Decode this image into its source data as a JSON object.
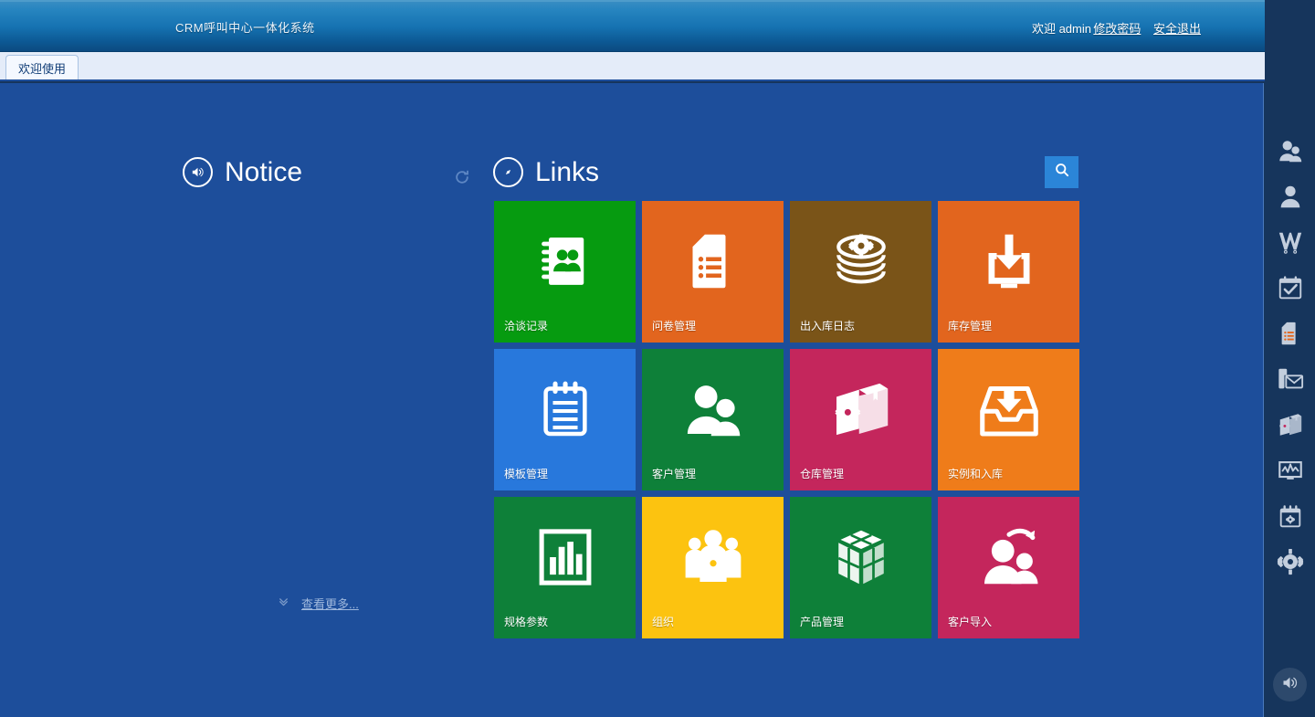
{
  "header": {
    "app_title": "CRM呼叫中心一体化系统",
    "welcome": "欢迎 admin",
    "change_password": "修改密码",
    "logout": "安全退出"
  },
  "tabbar": {
    "active_tab": "欢迎使用"
  },
  "notice": {
    "icon": "speaker-icon",
    "title": "Notice",
    "refresh_icon": "refresh-icon",
    "more_label": "查看更多...",
    "more_icon": "chevron-double-down-icon"
  },
  "links": {
    "icon": "compass-icon",
    "title": "Links",
    "search_icon": "search-icon"
  },
  "tiles": [
    {
      "label": "洽谈记录",
      "color": "#069b10",
      "icon": "contact-book-icon"
    },
    {
      "label": "问卷管理",
      "color": "#e2651e",
      "icon": "document-list-icon"
    },
    {
      "label": "出入库日志",
      "color": "#7a5418",
      "icon": "database-gear-icon"
    },
    {
      "label": "库存管理",
      "color": "#e2651e",
      "icon": "download-to-monitor-icon"
    },
    {
      "label": "模板管理",
      "color": "#2878dc",
      "icon": "notepad-icon"
    },
    {
      "label": "客户管理",
      "color": "#0e8039",
      "icon": "two-users-icon"
    },
    {
      "label": "仓库管理",
      "color": "#c4265c",
      "icon": "box-gear-icon"
    },
    {
      "label": "实例和入库",
      "color": "#ef7c1a",
      "icon": "inbox-download-icon"
    },
    {
      "label": "规格参数",
      "color": "#0e8039",
      "icon": "bar-chart-frame-icon"
    },
    {
      "label": "组织",
      "color": "#fcc310",
      "icon": "people-gear-icon"
    },
    {
      "label": "产品管理",
      "color": "#0e8039",
      "icon": "cube-blocks-icon"
    },
    {
      "label": "客户导入",
      "color": "#c4265c",
      "icon": "user-import-arrow-icon"
    }
  ],
  "rail": {
    "items": [
      {
        "icon": "two-users-icon",
        "name": "customers"
      },
      {
        "icon": "single-user-icon",
        "name": "user"
      },
      {
        "icon": "w-logo-icon",
        "name": "workflow"
      },
      {
        "icon": "calendar-check-icon",
        "name": "tasks"
      },
      {
        "icon": "document-list-icon",
        "name": "documents"
      },
      {
        "icon": "mail-phone-icon",
        "name": "messages"
      },
      {
        "icon": "box-gear-icon",
        "name": "inventory"
      },
      {
        "icon": "chart-monitor-icon",
        "name": "reports"
      },
      {
        "icon": "calendar-gear-icon",
        "name": "schedule-settings"
      },
      {
        "icon": "gear-icon",
        "name": "settings"
      }
    ],
    "bottom_icon": "speaker-icon"
  },
  "colors": {
    "panel_bg": "#1d4e9b",
    "rail_bg": "#16355c",
    "header_top": "#3b8fc4",
    "header_bottom": "#0b4a80",
    "tab_bg": "#e4ecf9",
    "accent": "#2b85d8"
  }
}
